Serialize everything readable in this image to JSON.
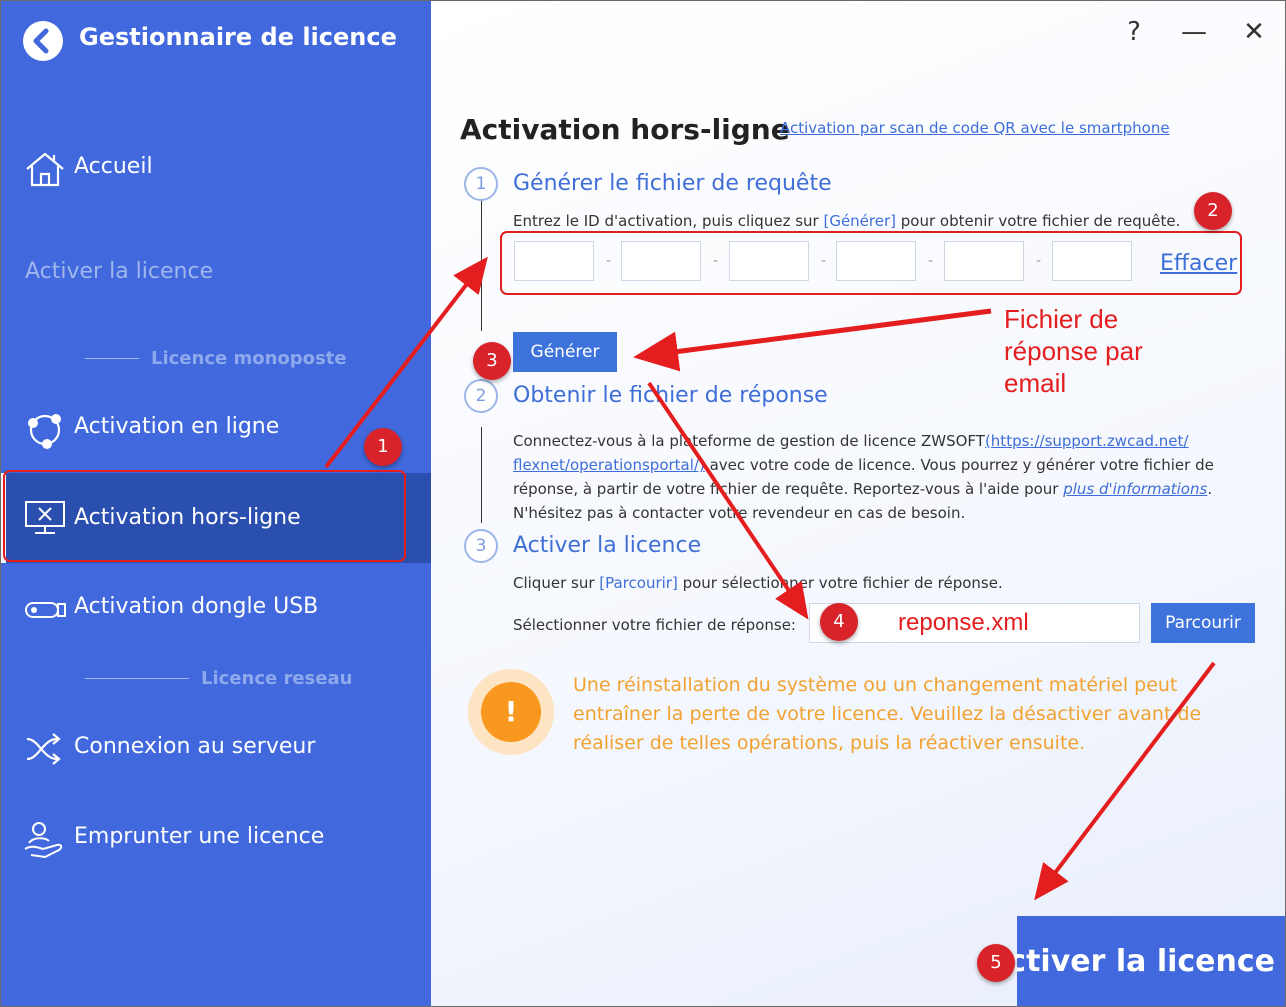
{
  "window": {
    "title": "Gestionnaire de licence",
    "controls": {
      "help": "?",
      "minimize": "—",
      "close": "✕"
    }
  },
  "sidebar": {
    "items": [
      {
        "label": "Accueil",
        "icon": "home-icon"
      },
      {
        "label": "Activation en ligne",
        "icon": "network-icon"
      },
      {
        "label": "Activation hors-ligne",
        "icon": "monitor-offline-icon",
        "active": true
      },
      {
        "label": "Activation dongle USB",
        "icon": "usb-dongle-icon"
      },
      {
        "label": "Connexion au serveur",
        "icon": "shuffle-icon"
      },
      {
        "label": "Emprunter une licence",
        "icon": "hand-user-icon"
      }
    ],
    "section_label": "Activer la licence",
    "subheads": {
      "standalone": "Licence monoposte",
      "network": "Licence reseau"
    }
  },
  "main": {
    "title": "Activation hors-ligne",
    "qr_link": "Activation par scan de code QR avec le smartphone",
    "steps": [
      {
        "number": "1",
        "title": "Générer le fichier de requête"
      },
      {
        "number": "2",
        "title": "Obtenir le fichier de réponse"
      },
      {
        "number": "3",
        "title": "Activer la licence"
      }
    ],
    "step1": {
      "instr_before": "Entrez le ID d'activation, puis cliquez sur ",
      "instr_keyword": "[Générer]",
      "instr_after": " pour obtenir votre fichier de requête.",
      "separator": "-",
      "clear_label": "Effacer",
      "generate_label": "Générer"
    },
    "step2": {
      "p1": "Connectez-vous à la plateforme de gestion de licence ZWSOFT",
      "link": "(https://support.zwcad.net/​flexnet/operationsportal/)",
      "p2": " avec votre code de licence. Vous pourrez y générer votre fichier de réponse, à partir de votre fichier de requête. Reportez-vous à l'aide pour ",
      "help_link": "plus d'informations",
      "p3": ". N'hésitez pas à contacter votre revendeur en cas de besoin."
    },
    "step3": {
      "instr_before": "Cliquer sur ",
      "instr_keyword": "[Parcourir]",
      "instr_after": " pour sélectionner votre fichier de réponse.",
      "select_label": "Sélectionner votre fichier de réponse:",
      "file_value": "reponse.xml",
      "browse_label": "Parcourir"
    },
    "warning": {
      "icon_text": "!",
      "text": "Une réinstallation du système ou un changement matériel peut entraîner la perte de votre licence. Veuillez la désactiver avant de réaliser de telles opérations, puis la réactiver ensuite."
    },
    "activate_label": "Activer la licence"
  },
  "annotations": {
    "badges": [
      "1",
      "2",
      "3",
      "4",
      "5"
    ],
    "note": [
      "Fichier de",
      "réponse par",
      "email"
    ],
    "color": "#e41e1e"
  },
  "colors": {
    "sidebar": "#4169dd",
    "sidebar_active": "#2a4fae",
    "accent": "#3f73dc",
    "link": "#3d6ed9",
    "warning": "#f9981f",
    "annotation": "#d8232a"
  }
}
